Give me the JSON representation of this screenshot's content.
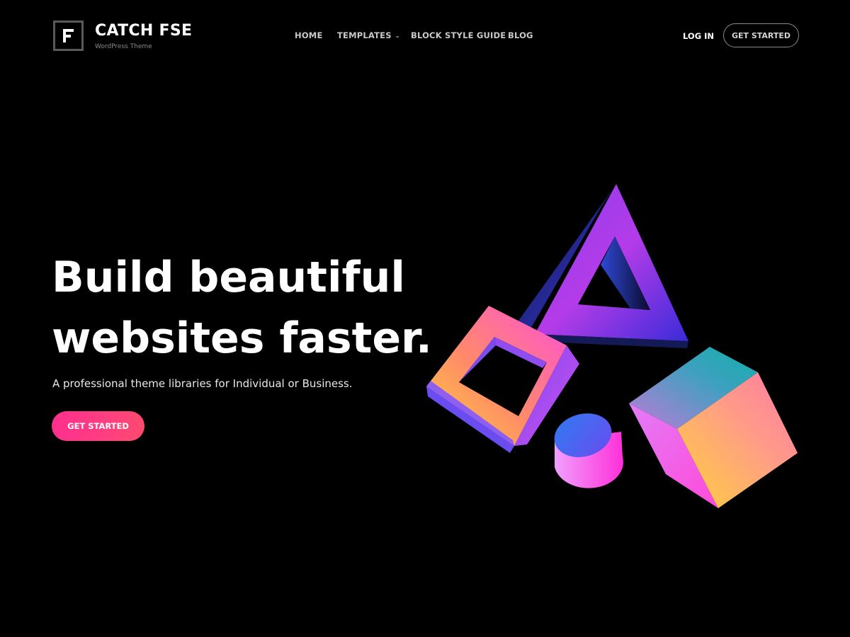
{
  "header": {
    "site_title": "CATCH FSE",
    "site_tagline": "WordPress Theme",
    "nav": {
      "home": "HOME",
      "templates": "TEMPLATES",
      "block_style_guide": "BLOCK STYLE GUIDE",
      "blog": "BLOG"
    },
    "login": "LOG IN",
    "get_started": "GET STARTED"
  },
  "hero": {
    "title_line1": "Build beautiful",
    "title_line2": "websites faster.",
    "subtitle": "A professional theme libraries for Individual or Business.",
    "cta": "GET STARTED"
  },
  "colors": {
    "background": "#000000",
    "accent": "#ff2f8e",
    "nav_text": "#c9c9c9",
    "text": "#ffffff"
  },
  "icons": {
    "logo": "letter-f-logo-icon",
    "templates_dropdown": "chevron-down-icon"
  },
  "illustration": {
    "shapes": [
      "triangle",
      "square-frame",
      "cylinder",
      "cube"
    ]
  }
}
